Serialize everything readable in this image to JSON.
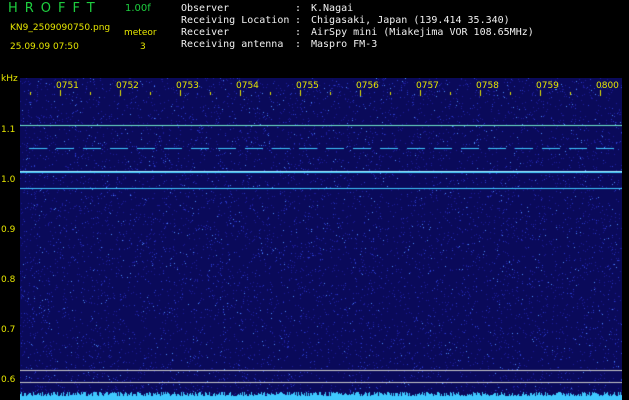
{
  "header": {
    "app_title": "HROFFT",
    "version": "1.00f",
    "filename": "KN9_2509090750.png",
    "mode": "meteor",
    "datetime": "25.09.09 07:50",
    "count": "3"
  },
  "info": [
    {
      "key": "Observer",
      "value": "K.Nagai"
    },
    {
      "key": "Receiving Location",
      "value": "Chigasaki, Japan (139.414 35.340)"
    },
    {
      "key": "Receiver",
      "value": "AirSpy mini (Miakejima VOR 108.65MHz)"
    },
    {
      "key": "Receiving antenna",
      "value": "Maspro FM-3"
    }
  ],
  "spectrogram": {
    "y_unit": "kHz",
    "y_ticks": [
      "1.1",
      "1.0",
      "0.9",
      "0.8",
      "0.7",
      "0.6"
    ],
    "x_ticks": [
      "0751",
      "0752",
      "0753",
      "0754",
      "0755",
      "0756",
      "0757",
      "0758",
      "0759",
      "0800"
    ],
    "colors": {
      "background": "#0a0a5a",
      "signal": "#3fc8ff",
      "strong": "#9ff0ff",
      "marker": "#e6e600"
    }
  }
}
